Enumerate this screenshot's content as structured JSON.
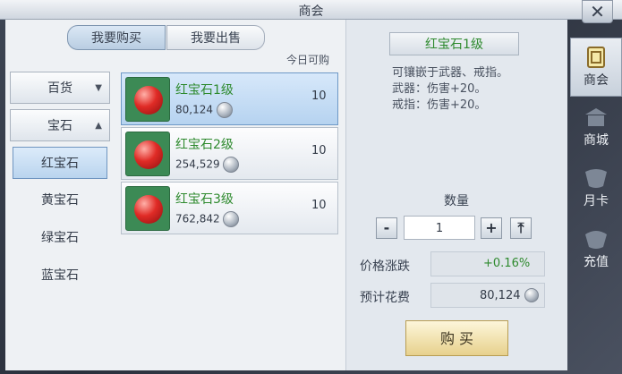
{
  "window": {
    "title": "商会",
    "close_label": "✕"
  },
  "tabs": [
    {
      "label": "我要购买",
      "active": true
    },
    {
      "label": "我要出售",
      "active": false
    }
  ],
  "today_label": "今日可购",
  "categories": [
    {
      "label": "百货",
      "arrow": "▼"
    },
    {
      "label": "宝石",
      "arrow": "▲"
    }
  ],
  "subcategories": [
    "红宝石",
    "黄宝石",
    "绿宝石",
    "蓝宝石"
  ],
  "items": [
    {
      "name": "红宝石1级",
      "price": "80,124",
      "qty": "10"
    },
    {
      "name": "红宝石2级",
      "price": "254,529",
      "qty": "10"
    },
    {
      "name": "红宝石3级",
      "price": "762,842",
      "qty": "10"
    }
  ],
  "detail": {
    "title": "红宝石1级",
    "desc": [
      "可镶嵌于武器、戒指。",
      "武器：伤害+20。",
      "戒指：伤害+20。"
    ],
    "quantity_label": "数量",
    "quantity": "1",
    "minus": "-",
    "plus": "+",
    "max": "⤒",
    "price_change_label": "价格涨跌",
    "price_change": "+0.16%",
    "cost_label": "预计花费",
    "cost": "80,124",
    "buy_label": "购 买"
  },
  "nav": [
    {
      "label": "商会"
    },
    {
      "label": "商城"
    },
    {
      "label": "月卡"
    },
    {
      "label": "充值"
    }
  ],
  "colors": {
    "green_text": "#2e8a2e",
    "gem_red": "#e02b26",
    "item_bg": "#3c8a55"
  }
}
